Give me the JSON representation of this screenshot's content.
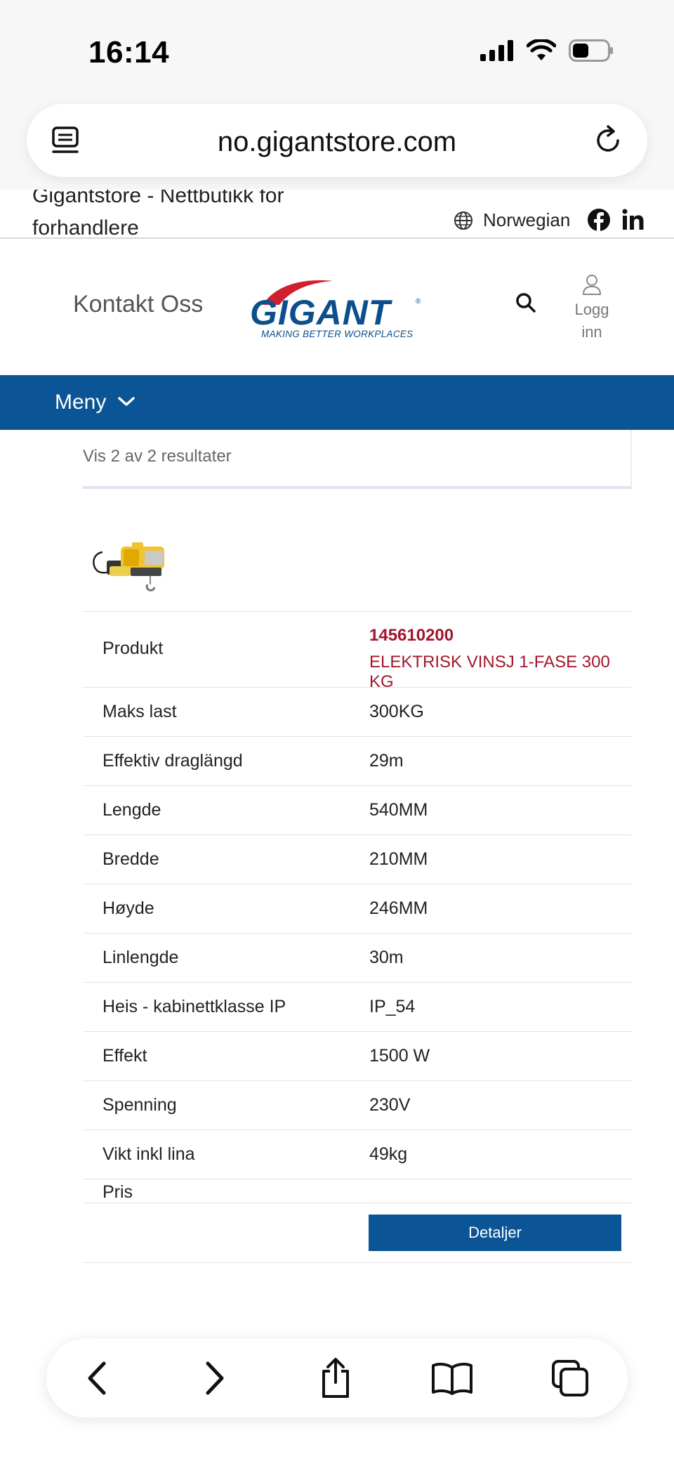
{
  "status_bar": {
    "time": "16:14"
  },
  "browser": {
    "url": "no.gigantstore.com"
  },
  "site_strip": {
    "tagline": "Gigantstore - Nettbutikk for forhandlere",
    "language": "Norwegian"
  },
  "header": {
    "contact_label": "Kontakt Oss",
    "logo_text": "GIGANT",
    "logo_tagline": "MAKING BETTER WORKPLACES",
    "login_line1": "Logg",
    "login_line2": "inn"
  },
  "menu": {
    "label": "Meny"
  },
  "results": {
    "text": "Vis 2 av 2 resultater"
  },
  "product": {
    "label": "Produkt",
    "code": "145610200",
    "name": "ELEKTRISK VINSJ 1-FASE 300 KG"
  },
  "specs": [
    {
      "label": "Maks last",
      "value": "300KG"
    },
    {
      "label": "Effektiv draglängd",
      "value": "29m"
    },
    {
      "label": "Lengde",
      "value": "540MM"
    },
    {
      "label": "Bredde",
      "value": "210MM"
    },
    {
      "label": "Høyde",
      "value": "246MM"
    },
    {
      "label": "Linlengde",
      "value": "30m"
    },
    {
      "label": "Heis - kabinettklasse IP",
      "value": "IP_54"
    },
    {
      "label": "Effekt",
      "value": "1500 W"
    },
    {
      "label": "Spenning",
      "value": "230V"
    },
    {
      "label": "Vikt inkl lina",
      "value": "49kg"
    }
  ],
  "price": {
    "label": "Pris"
  },
  "details_button": {
    "label": "Detaljer"
  },
  "colors": {
    "brand_blue": "#0b5596",
    "product_red": "#a3162c",
    "logo_red": "#d0202e"
  },
  "icons": {
    "tabs": "tabs-list-icon",
    "reload": "reload-icon",
    "globe": "globe-icon",
    "facebook": "facebook-icon",
    "linkedin": "linkedin-icon",
    "search": "search-icon",
    "user": "user-icon",
    "chevron": "chevron-down-icon",
    "back": "back-arrow-icon",
    "forward": "forward-arrow-icon",
    "share": "share-icon",
    "bookmarks": "bookmarks-icon",
    "tab_switcher": "tab-switcher-icon"
  }
}
